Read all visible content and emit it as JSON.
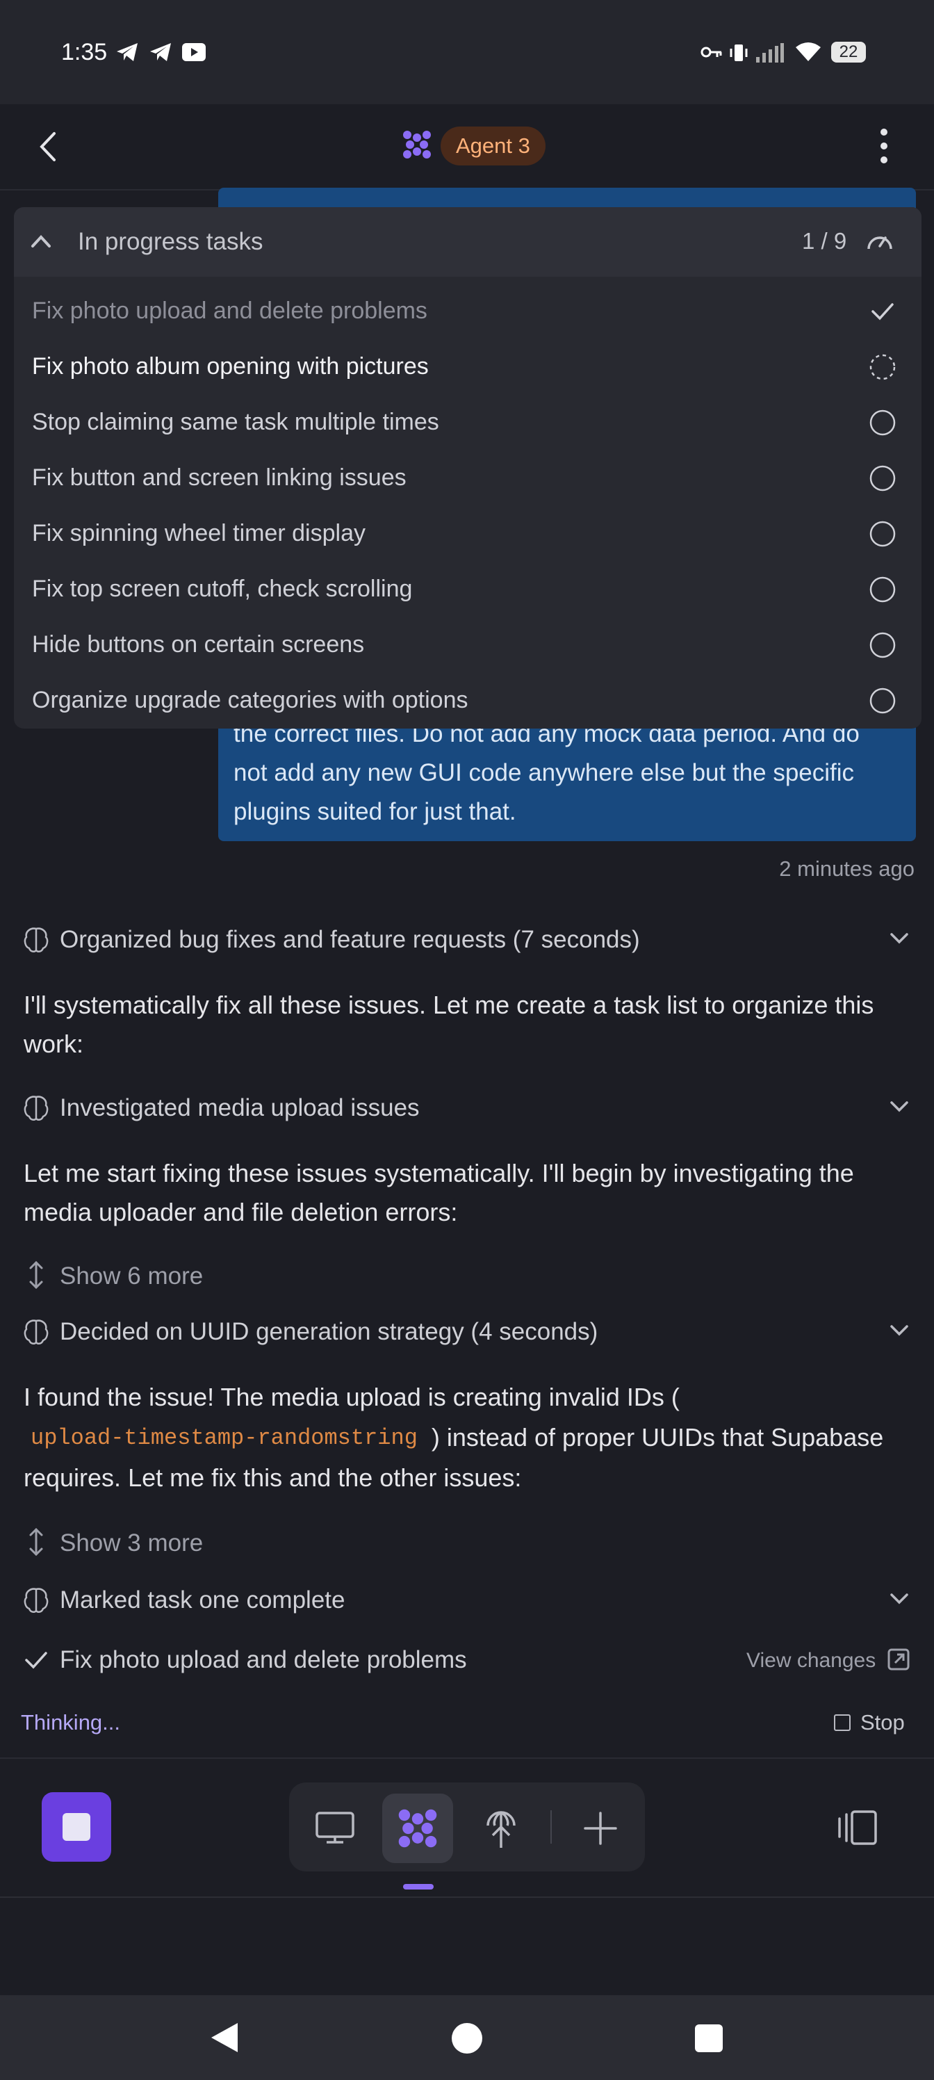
{
  "status_bar": {
    "time": "1:35",
    "battery": "22"
  },
  "header": {
    "agent_label": "Agent 3"
  },
  "task_panel": {
    "title": "In progress tasks",
    "progress": "1 / 9",
    "tasks": [
      {
        "label": "Fix photo upload and delete problems",
        "state": "done"
      },
      {
        "label": "Fix photo album opening with pictures",
        "state": "in-progress"
      },
      {
        "label": "Stop claiming same task multiple times",
        "state": "pending"
      },
      {
        "label": "Fix button and screen linking issues",
        "state": "pending"
      },
      {
        "label": "Fix spinning wheel timer display",
        "state": "pending"
      },
      {
        "label": "Fix top screen cutoff, check scrolling",
        "state": "pending"
      },
      {
        "label": "Hide buttons on certain screens",
        "state": "pending"
      },
      {
        "label": "Organize upgrade categories with options",
        "state": "pending"
      }
    ]
  },
  "user_message": {
    "lines": [
      "the correct files. Do not add any mock data period. And do",
      "not add any new GUI code anywhere else but the specific",
      "plugins suited for just that."
    ],
    "timestamp": "2 minutes ago"
  },
  "chat": {
    "thought1": "Organized bug fixes and feature requests (7 seconds)",
    "para1_line1": "I'll systematically fix all these issues. Let me create a task list to organize this",
    "para1_line2": "work:",
    "thought2": "Investigated media upload issues",
    "para2_line1": "Let me start fixing these issues systematically. I'll begin by investigating the",
    "para2_line2": "media uploader and file deletion errors:",
    "show_more_1": "Show 6 more",
    "thought3": "Decided on UUID generation strategy (4 seconds)",
    "para3_line1": "I found the issue! The media upload is creating invalid IDs (",
    "para3_code": "upload-timestamp-randomstring",
    "para3_after_code": ") instead of proper UUIDs that Supabase",
    "para3_line3": "requires. Let me fix this and the other issues:",
    "show_more_2": "Show 3 more",
    "thought4": "Marked task one complete",
    "completed_task": "Fix photo upload and delete problems",
    "view_changes": "View changes",
    "thinking": "Thinking...",
    "stop": "Stop"
  },
  "colors": {
    "accent": "#7c5cf0",
    "bubble": "#18497f",
    "code": "#e08a45"
  }
}
